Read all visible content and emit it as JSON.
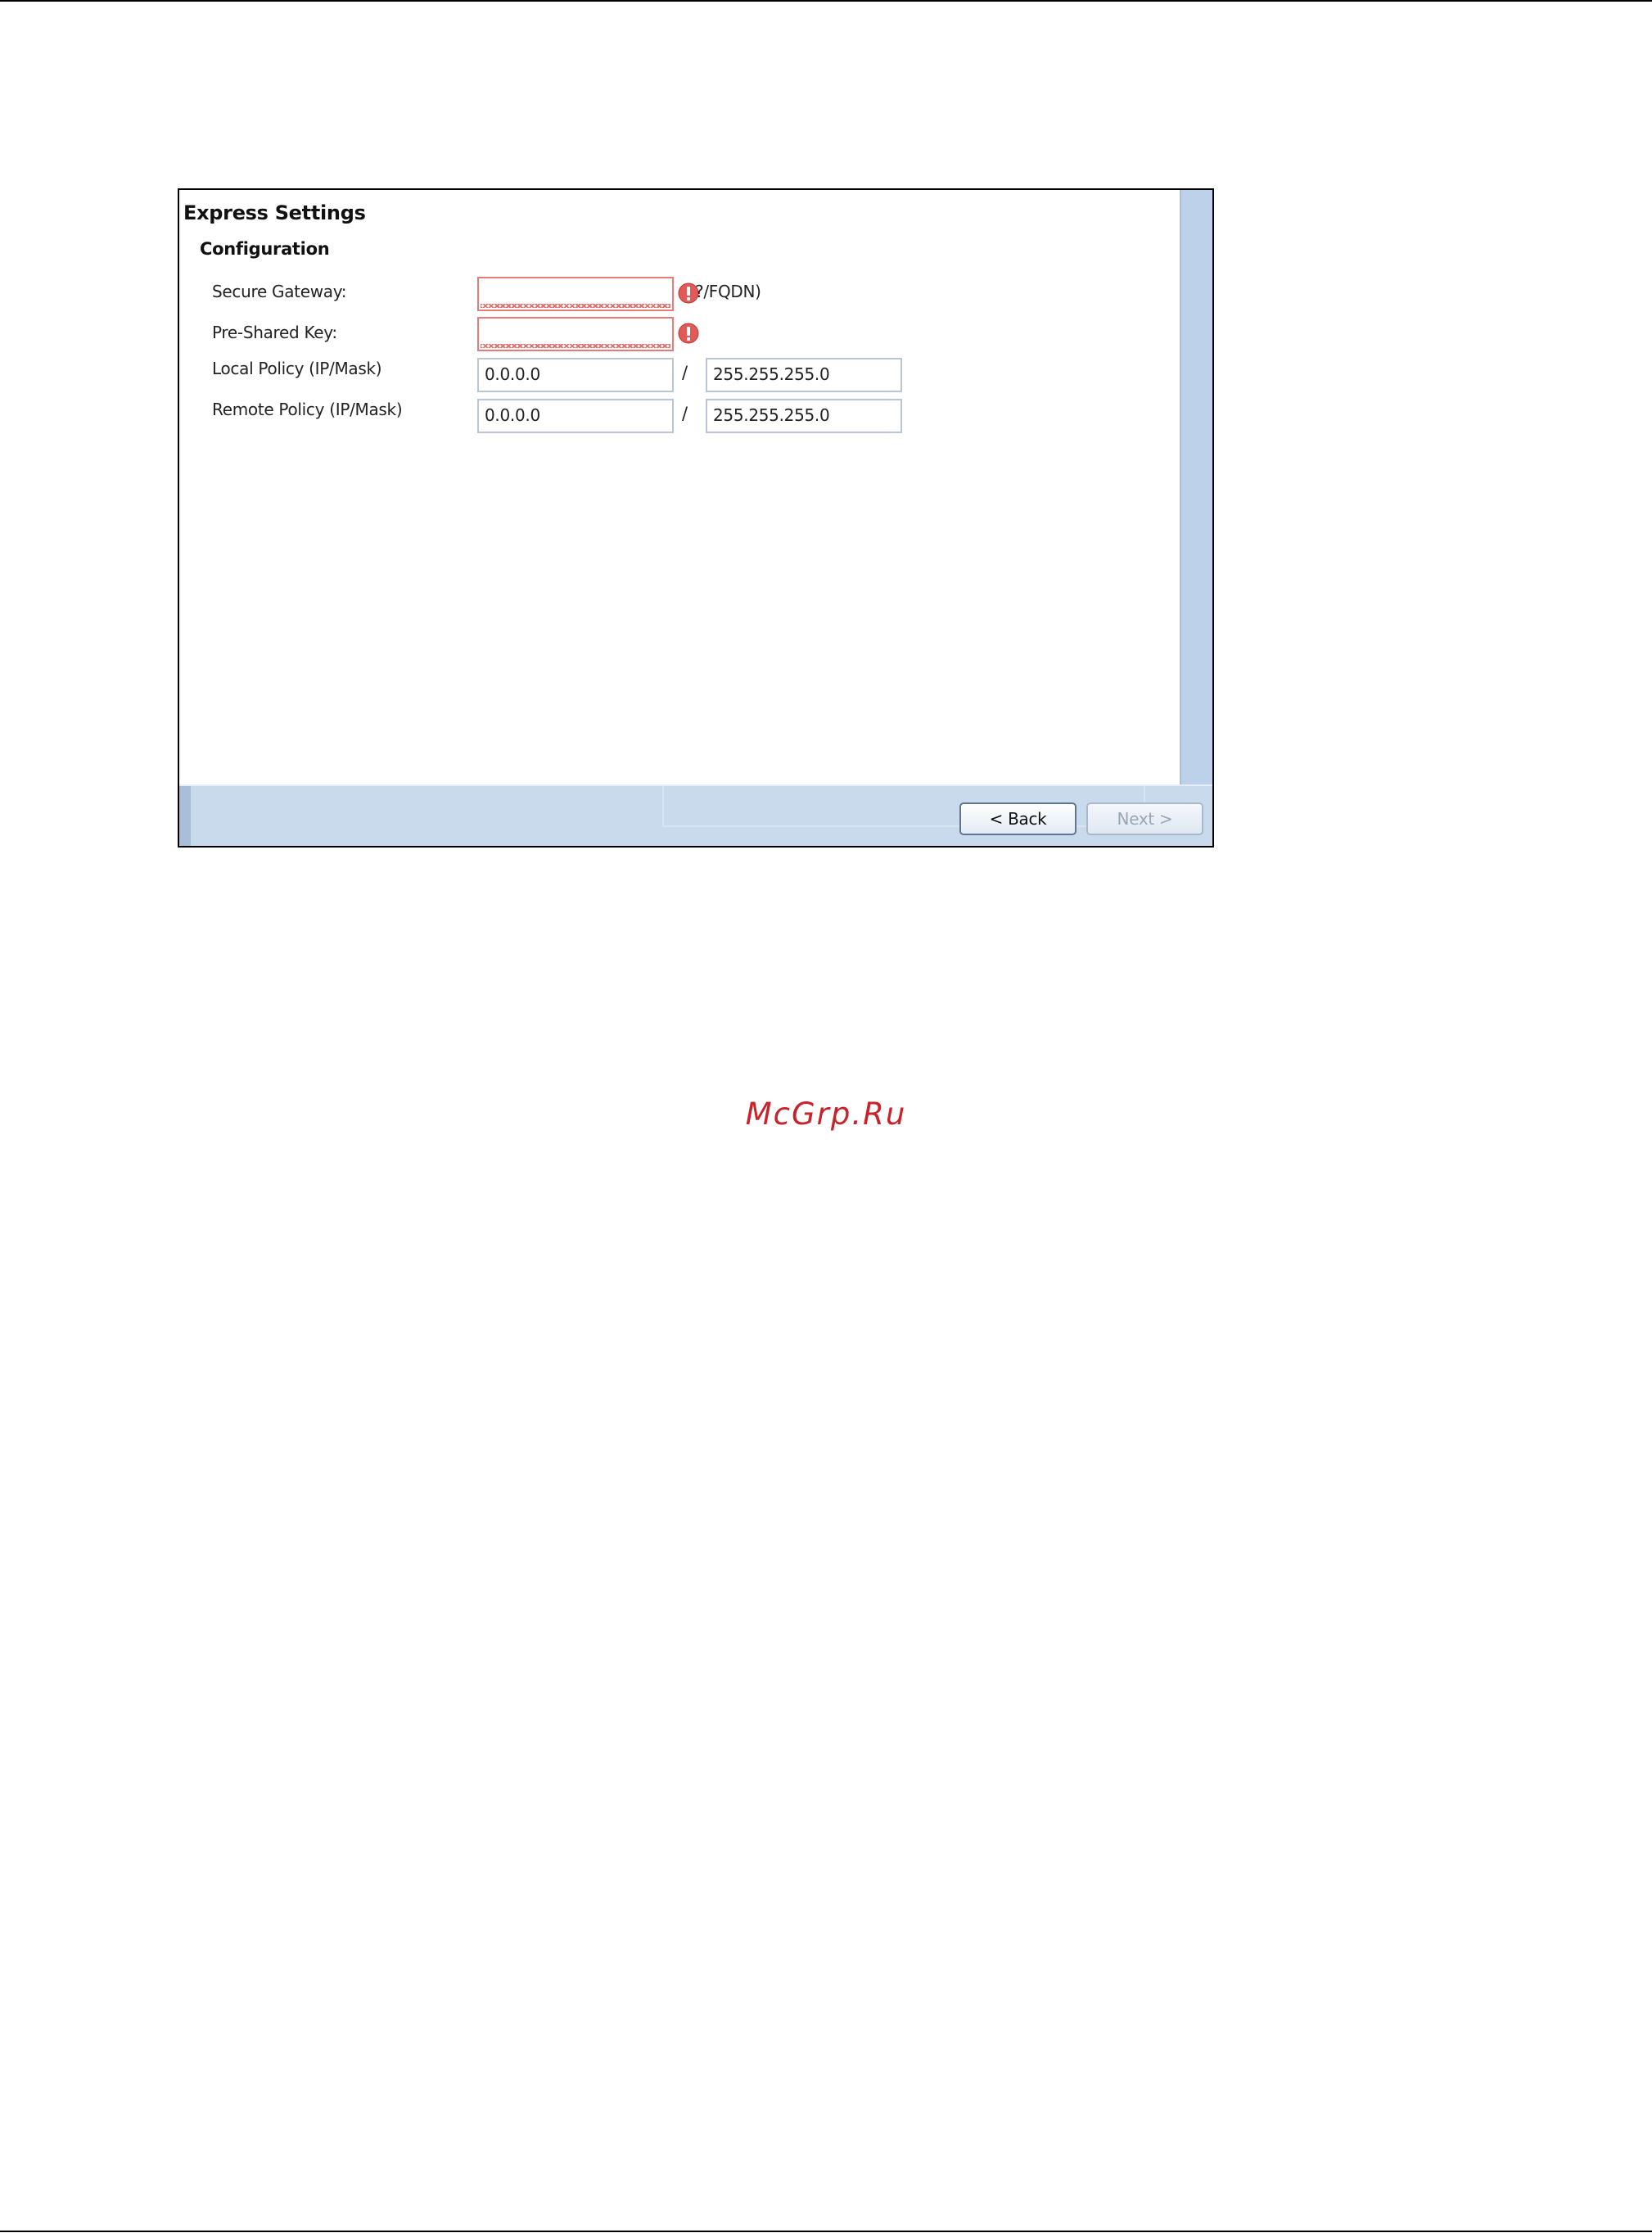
{
  "dialog": {
    "title": "Express Settings",
    "section": "Configuration",
    "fields": {
      "secure_gateway": {
        "label": "Secure Gateway:",
        "value": "",
        "hint": "?/FQDN)",
        "state": "error"
      },
      "pre_shared_key": {
        "label": "Pre-Shared Key:",
        "value": "",
        "state": "error"
      },
      "local_policy": {
        "label": "Local Policy (IP/Mask)",
        "ip": "0.0.0.0",
        "separator": "/",
        "mask": "255.255.255.0"
      },
      "remote_policy": {
        "label": "Remote Policy (IP/Mask)",
        "ip": "0.0.0.0",
        "separator": "/",
        "mask": "255.255.255.0"
      }
    },
    "buttons": {
      "back": "< Back",
      "next": "Next >"
    },
    "colors": {
      "error": "#e25a58",
      "scrollbar": "#bdd2ea",
      "footer": "#c9daec"
    }
  },
  "watermark": "McGrp.Ru"
}
